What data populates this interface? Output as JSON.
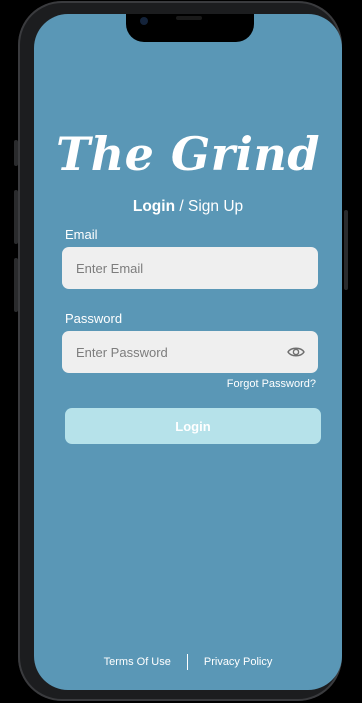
{
  "app": {
    "brand_title": "The Grind"
  },
  "auth_tabs": {
    "login": "Login",
    "separator": "/",
    "signup": "Sign Up"
  },
  "email": {
    "label": "Email",
    "placeholder": "Enter Email",
    "value": ""
  },
  "password": {
    "label": "Password",
    "placeholder": "Enter Password",
    "value": ""
  },
  "forgot_password": "Forgot Password?",
  "login_button": "Login",
  "footer": {
    "terms": "Terms Of Use",
    "privacy": "Privacy Policy"
  },
  "colors": {
    "screen_background": "#5a97b6",
    "field_background": "#efefef",
    "button_background": "#b6e2ea"
  },
  "icons": {
    "password_toggle": "eye-icon"
  }
}
